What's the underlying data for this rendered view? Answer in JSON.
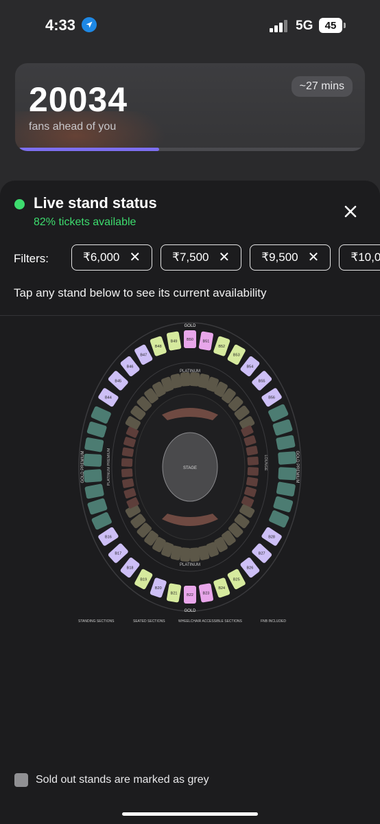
{
  "status_bar": {
    "time": "4:33",
    "network": "5G",
    "battery": "45",
    "location_icon": "location-arrow-icon"
  },
  "queue": {
    "count": "20034",
    "label": "fans ahead of you",
    "eta": "~27 mins",
    "progress": 0.41,
    "accent": "#7d6ff0"
  },
  "sheet": {
    "title": "Live stand status",
    "availability": "82% tickets available",
    "status_color": "#3ddc6e",
    "close_icon": "close-icon",
    "filters_label": "Filters:",
    "filters": [
      {
        "label": "₹6,000"
      },
      {
        "label": "₹7,500"
      },
      {
        "label": "₹9,500"
      },
      {
        "label": "₹10,0"
      }
    ],
    "hint": "Tap any stand below to see its current availability",
    "sold_out_note": "Sold out stands are marked as grey"
  },
  "map": {
    "stage": "STAGE",
    "labels": {
      "gold": "GOLD",
      "platinum": "PLATINUM",
      "gold_premium": "GOLD PREMIUM",
      "platinum_premium": "PLATINUM PREMIUM",
      "lounge": "LOUNGE"
    },
    "top_stands": [
      "B44",
      "B45",
      "B46",
      "B47",
      "B48",
      "B49",
      "B50",
      "B51",
      "B52",
      "B53",
      "B54",
      "B55",
      "B56"
    ],
    "bottom_stands": [
      "B16",
      "B17",
      "B18",
      "B19",
      "B20",
      "B21",
      "B22",
      "B23",
      "B24",
      "B25",
      "B26",
      "B27",
      "B28"
    ],
    "legend": [
      "STANDING SECTIONS",
      "SEATED SECTIONS",
      "WHEELCHAIR ACCESSIBLE SECTIONS",
      "FNB INCLUDED"
    ],
    "colors": {
      "pink": "#e8a6ea",
      "green": "#d6ea9e",
      "lavender": "#cdbff6",
      "teal": "#4c7c72",
      "platinum": "#5c5748",
      "premium": "#5d3e3a"
    }
  }
}
